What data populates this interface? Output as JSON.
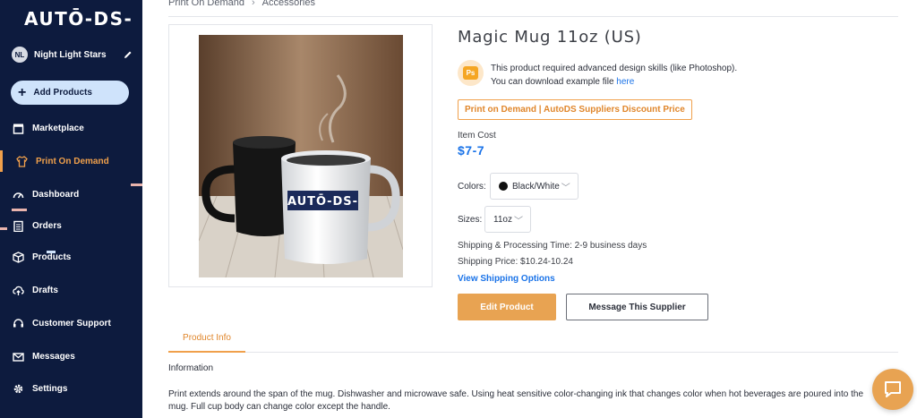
{
  "sidebar": {
    "logo": "AUTŌ-DS-",
    "store": {
      "initials": "NL",
      "name": "Night Light Stars"
    },
    "add_products_label": "Add Products",
    "items": [
      {
        "label": "Marketplace",
        "icon": "store-icon"
      },
      {
        "label": "Print On Demand",
        "icon": "shirt-icon",
        "active": true
      },
      {
        "label": "Dashboard",
        "icon": "gauge-icon"
      },
      {
        "label": "Orders",
        "icon": "clipboard-icon"
      },
      {
        "label": "Products",
        "icon": "box-icon"
      },
      {
        "label": "Drafts",
        "icon": "cloud-upload-icon"
      },
      {
        "label": "Customer Support",
        "icon": "headset-icon"
      },
      {
        "label": "Messages",
        "icon": "envelope-icon"
      },
      {
        "label": "Settings",
        "icon": "gear-icon"
      }
    ]
  },
  "breadcrumb": {
    "parent": "Print On Demand",
    "current": "Accessories"
  },
  "product": {
    "image_logo_text": "AUTŌ-DS-",
    "title": "Magic Mug 11oz (US)",
    "notice_line1": "This product required advanced design skills (like Photoshop).",
    "notice_line2": "You can download example file",
    "notice_link": "here",
    "ps_badge": "Ps",
    "tag": "Print on Demand | AutoDS Suppliers Discount Price",
    "cost_label": "Item Cost",
    "cost_value": "$7-7",
    "colors_label": "Colors:",
    "color_value": "Black/White",
    "sizes_label": "Sizes:",
    "size_value": "11oz",
    "shipping_time": "Shipping & Processing Time: 2-9 business days",
    "shipping_price": "Shipping Price: $10.24-10.24",
    "shipping_link": "View Shipping Options",
    "edit_button": "Edit Product",
    "message_button": "Message This Supplier"
  },
  "tabs": {
    "product_info": "Product Info"
  },
  "info": {
    "heading": "Information",
    "description": "Print extends around the span of the mug. Dishwasher and microwave safe. Using heat sensitive color-changing ink that changes color when hot beverages are poured into the mug. Full cup body can change color except the handle."
  },
  "colors": {
    "sidebar_bg": "#0d1b3e",
    "accent": "#f0a04b",
    "link": "#1a73e8"
  }
}
